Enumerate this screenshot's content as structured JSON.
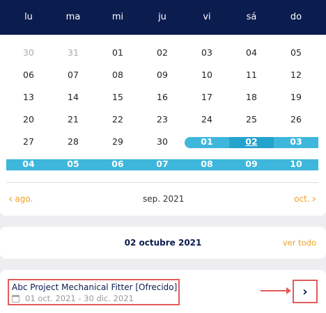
{
  "calendar": {
    "weekdays": [
      "lu",
      "ma",
      "mi",
      "ju",
      "vi",
      "sá",
      "do"
    ],
    "weeks": [
      [
        {
          "d": "30",
          "muted": true
        },
        {
          "d": "31",
          "muted": true
        },
        {
          "d": "01"
        },
        {
          "d": "02"
        },
        {
          "d": "03"
        },
        {
          "d": "04"
        },
        {
          "d": "05"
        }
      ],
      [
        {
          "d": "06"
        },
        {
          "d": "07"
        },
        {
          "d": "08"
        },
        {
          "d": "09"
        },
        {
          "d": "10"
        },
        {
          "d": "11"
        },
        {
          "d": "12"
        }
      ],
      [
        {
          "d": "13"
        },
        {
          "d": "14"
        },
        {
          "d": "15"
        },
        {
          "d": "16"
        },
        {
          "d": "17"
        },
        {
          "d": "18"
        },
        {
          "d": "19"
        }
      ],
      [
        {
          "d": "20"
        },
        {
          "d": "21"
        },
        {
          "d": "22"
        },
        {
          "d": "23"
        },
        {
          "d": "24"
        },
        {
          "d": "25"
        },
        {
          "d": "26"
        }
      ],
      [
        {
          "d": "27"
        },
        {
          "d": "28"
        },
        {
          "d": "29"
        },
        {
          "d": "30"
        },
        {
          "d": "01",
          "sel": true
        },
        {
          "d": "02",
          "sel": true,
          "today": true
        },
        {
          "d": "03",
          "sel": true
        }
      ],
      [
        {
          "d": "04",
          "sel": true
        },
        {
          "d": "05",
          "sel": true
        },
        {
          "d": "06",
          "sel": true
        },
        {
          "d": "07",
          "sel": true
        },
        {
          "d": "08",
          "sel": true
        },
        {
          "d": "09",
          "sel": true
        },
        {
          "d": "10",
          "sel": true
        }
      ]
    ],
    "prev_label": "ago.",
    "month_label": "sep. 2021",
    "next_label": "oct.",
    "prev_icon": "chevron-left-icon",
    "next_icon": "chevron-right-icon"
  },
  "selected": {
    "date_title": "02 octubre 2021",
    "see_all_label": "ver todo"
  },
  "event": {
    "title": "Abc Project Mechanical Fitter [Ofrecido]",
    "dates": "01 oct. 2021 - 30 dic. 2021",
    "date_icon": "calendar-icon",
    "open_icon": "chevron-right-icon"
  },
  "colors": {
    "header_bg": "#0b1c4e",
    "range": "#3fb7dc",
    "accent": "#f0a020",
    "highlight": "#e35a5a"
  }
}
